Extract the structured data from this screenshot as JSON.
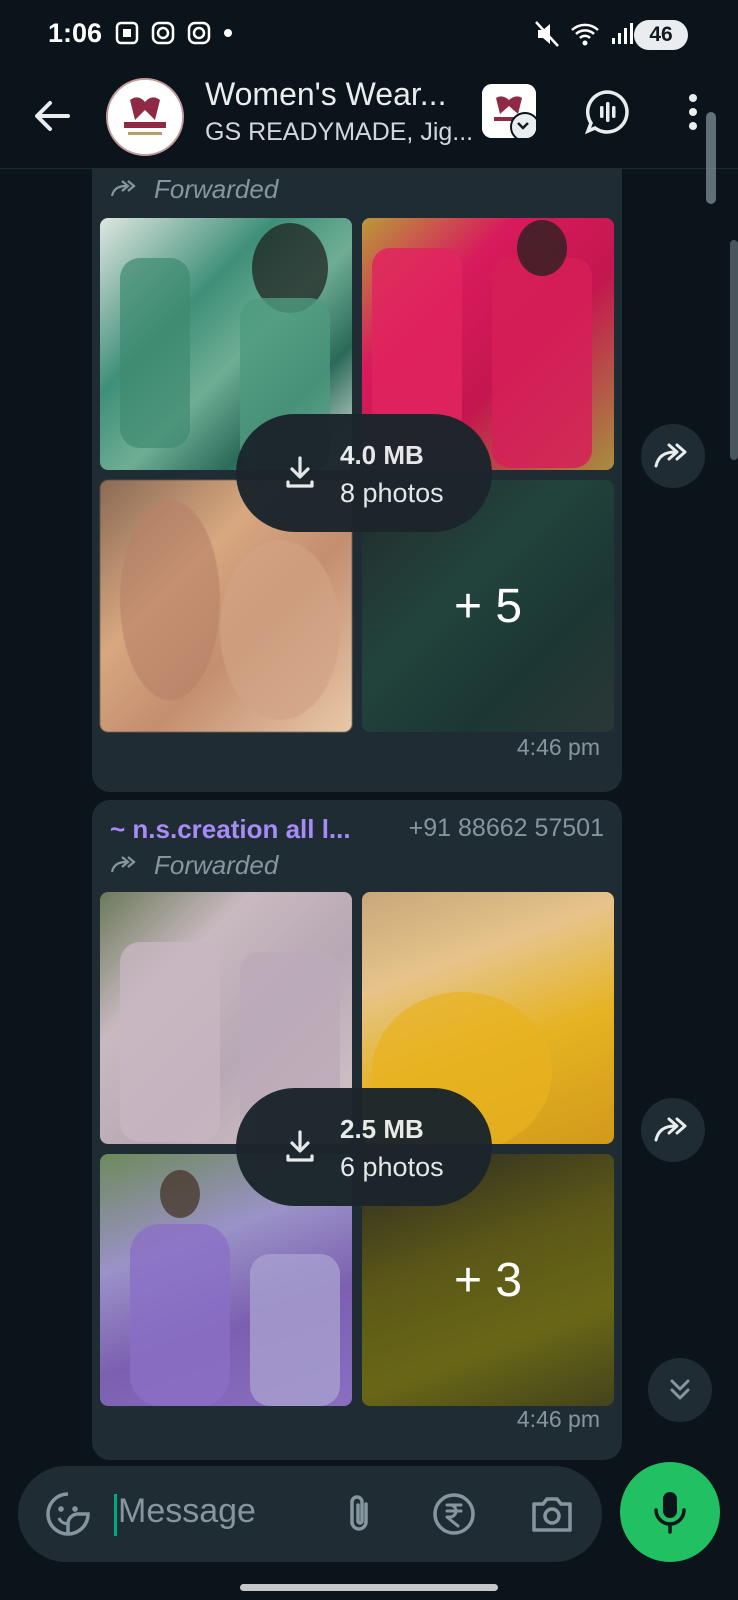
{
  "status_bar": {
    "time": "1:06",
    "battery": "46"
  },
  "header": {
    "title": "Women's Wear...",
    "subtitle": "GS READYMADE, Jig..."
  },
  "messages": [
    {
      "forwarded_label": "Forwarded",
      "download_size": "4.0 MB",
      "photo_count": "8 photos",
      "more_count": "+ 5",
      "time": "4:46 pm"
    },
    {
      "sender": "~ n.s.creation all l...",
      "phone": "+91 88662 57501",
      "forwarded_label": "Forwarded",
      "download_size": "2.5 MB",
      "photo_count": "6 photos",
      "more_count": "+ 3",
      "time": "4:46 pm"
    }
  ],
  "composer": {
    "placeholder": "Message"
  },
  "colors": {
    "background": "#0b141a",
    "bubble": "#202c33",
    "accent_green": "#21c063",
    "sender_purple": "#a78bfa"
  },
  "icons": [
    "back-arrow-icon",
    "community-icon",
    "voice-call-icon",
    "more-options-icon",
    "forward-icon",
    "download-icon",
    "share-icon",
    "scroll-down-icon",
    "sticker-icon",
    "attach-icon",
    "rupee-icon",
    "camera-icon",
    "mic-icon"
  ]
}
